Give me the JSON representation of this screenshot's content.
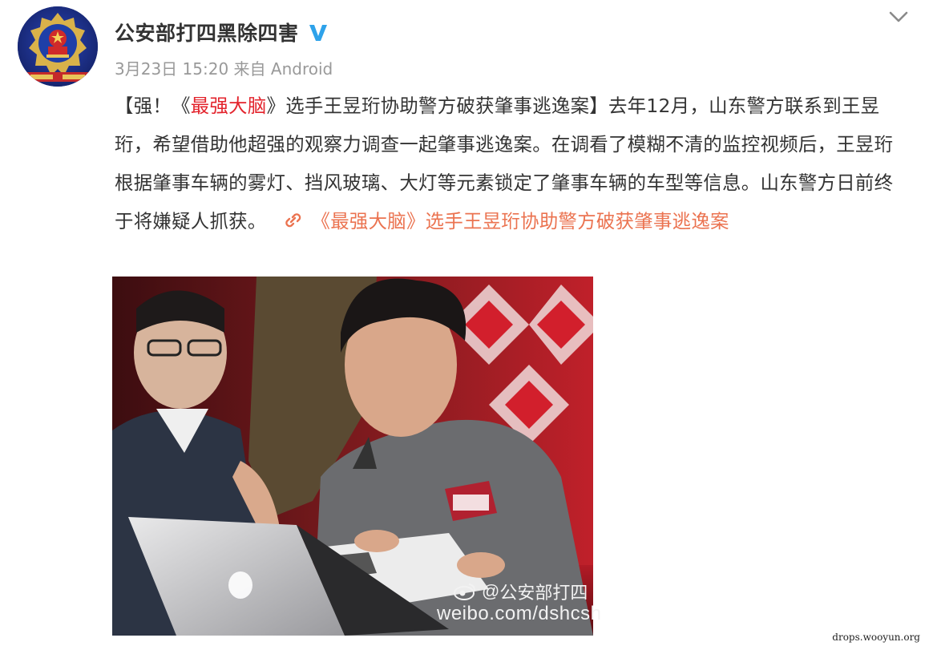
{
  "post": {
    "author_name": "公安部打四黑除四害",
    "verified_icon": "verified-v-icon",
    "date": "3月23日 15:20",
    "source_prefix": "来自",
    "source": "Android",
    "menu_icon": "chevron-down-icon",
    "text": {
      "bracket_open": "【强！《",
      "highlight": "最强大脑",
      "title_rest": "》选手王昱珩协助警方破获肇事逃逸案】",
      "body": "去年12月，山东警方联系到王昱珩，希望借助他超强的观察力调查一起肇事逃逸案。在调看了模糊不清的监控视频后，王昱珩根据肇事车辆的雾灯、挡风玻璃、大灯等元素锁定了肇事车辆的车型等信息。山东警方日前终于将嫌疑人抓获。",
      "link_icon": "link-icon",
      "link_label": "《最强大脑》选手王昱珩协助警方破获肇事逃逸案"
    },
    "image": {
      "watermark_brand": "公安部打四",
      "watermark_url": "weibo.com/dshcsh"
    }
  },
  "site_mark": "drops.wooyun.org",
  "colors": {
    "link": "#eb7350",
    "highlight": "#e3232c",
    "verified": "#2ea2ea",
    "meta": "#999999"
  }
}
